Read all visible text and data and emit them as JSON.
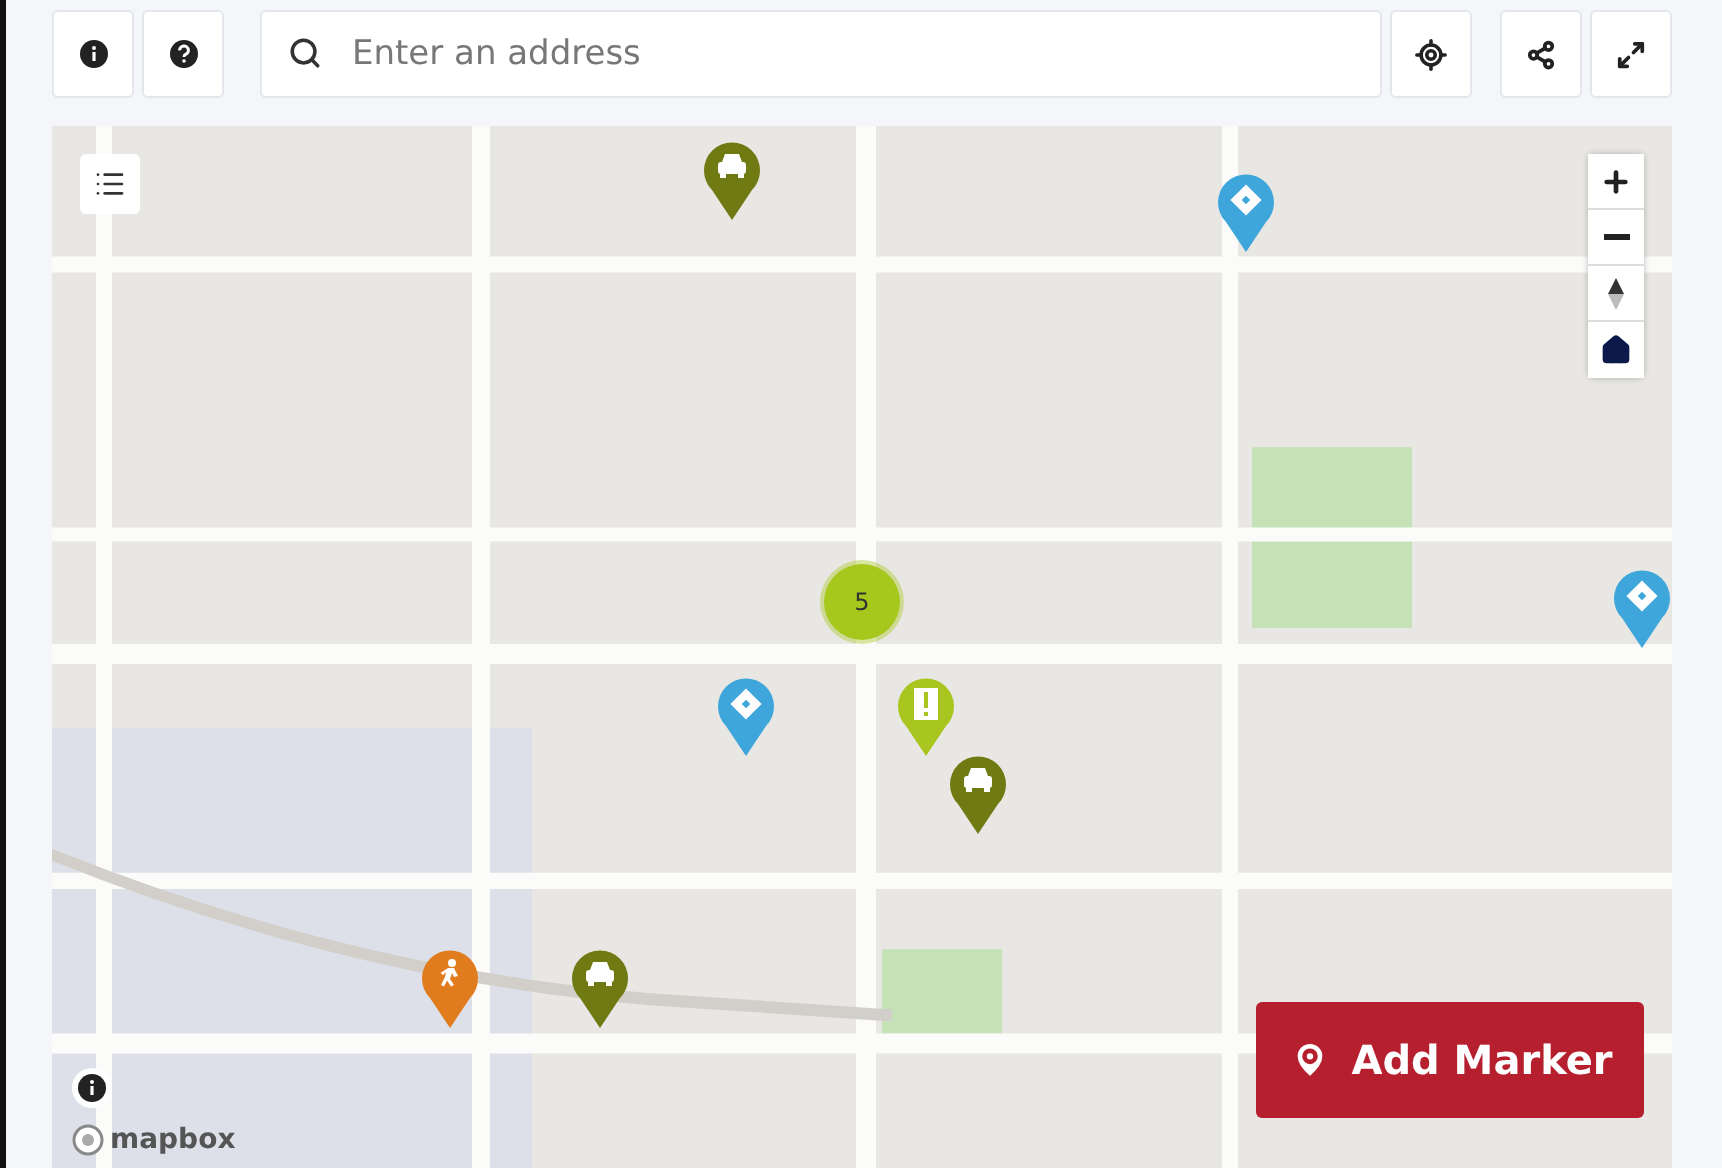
{
  "toolbar": {
    "search": {
      "placeholder": "Enter an address"
    }
  },
  "map": {
    "kind": "picture",
    "cluster": {
      "count": "5"
    },
    "markers": [
      {
        "kind": "car",
        "color": "#6f7a12"
      },
      {
        "kind": "diamond",
        "color": "#3fa6dc"
      },
      {
        "kind": "diamond",
        "color": "#3fa6dc"
      },
      {
        "kind": "diamond",
        "color": "#3fa6dc"
      },
      {
        "kind": "alert",
        "color": "#a9c620"
      },
      {
        "kind": "car",
        "color": "#6f7a12"
      },
      {
        "kind": "person",
        "color": "#e17c1e"
      },
      {
        "kind": "car",
        "color": "#6f7a12"
      }
    ],
    "attribution": "mapbox",
    "add_button": "Add Marker"
  }
}
